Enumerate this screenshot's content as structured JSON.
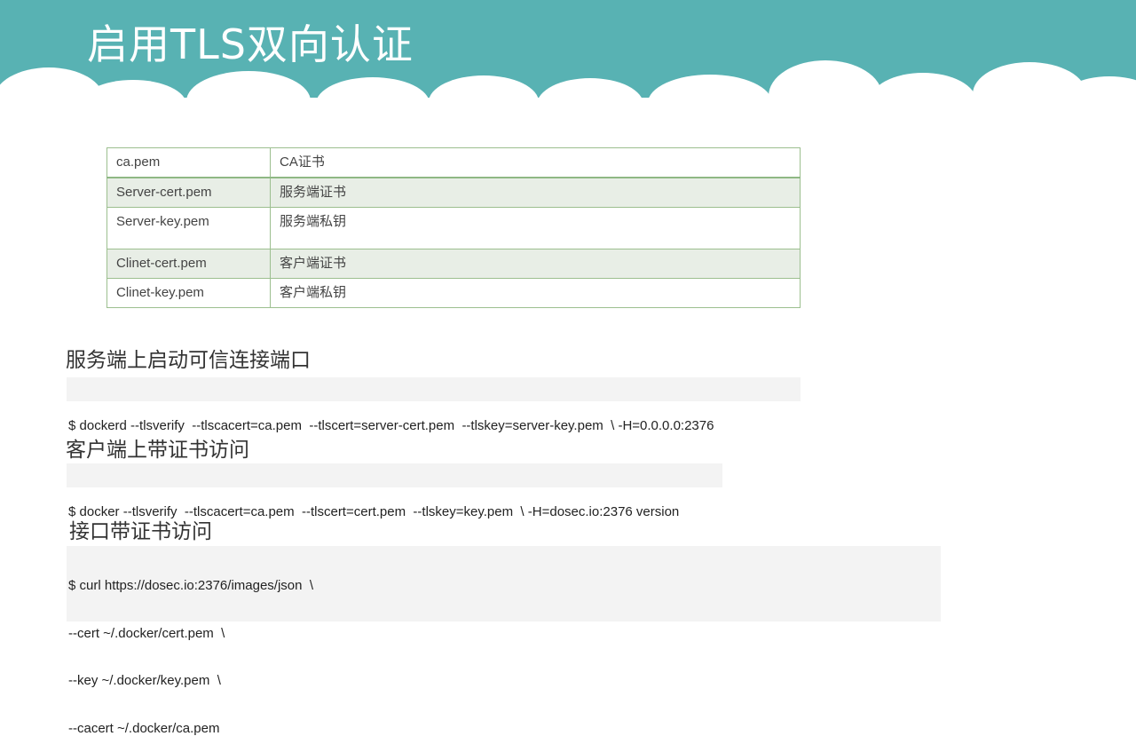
{
  "slide": {
    "title": "启用TLS双向认证",
    "colors": {
      "header": "#58b2b3",
      "table_border": "#9cbf8f",
      "row_shade": "#e8eee6",
      "code_bg": "#f3f3f3"
    }
  },
  "cert_table": {
    "rows": [
      {
        "file": "ca.pem",
        "desc": "CA证书"
      },
      {
        "file": "Server-cert.pem",
        "desc": "服务端证书"
      },
      {
        "file": "Server-key.pem",
        "desc": "服务端私钥"
      },
      {
        "file": "Clinet-cert.pem",
        "desc": "客户端证书"
      },
      {
        "file": "Clinet-key.pem",
        "desc": "客户端私钥"
      }
    ]
  },
  "sections": {
    "server": {
      "label": "服务端上启动可信连接端口",
      "code": "$ dockerd --tlsverify  --tlscacert=ca.pem  --tlscert=server-cert.pem  --tlskey=server-key.pem  \\ -H=0.0.0.0:2376"
    },
    "client": {
      "label": "客户端上带证书访问",
      "code": "$ docker --tlsverify  --tlscacert=ca.pem  --tlscert=cert.pem  --tlskey=key.pem  \\ -H=dosec.io:2376 version"
    },
    "api": {
      "label": "接口带证书访问",
      "lines": [
        "$ curl https://dosec.io:2376/images/json  \\",
        "--cert ~/.docker/cert.pem  \\",
        "--key ~/.docker/key.pem  \\",
        "--cacert ~/.docker/ca.pem"
      ]
    }
  }
}
